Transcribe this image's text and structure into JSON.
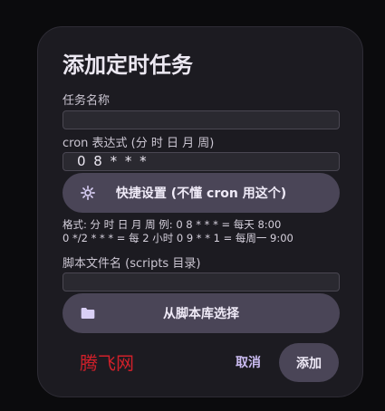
{
  "dialog": {
    "title": "添加定时任务",
    "task_name": {
      "label": "任务名称",
      "value": ""
    },
    "cron": {
      "label": "cron 表达式 (分 时 日 月 周)",
      "value": "0 8 * * *"
    },
    "quick_setup": {
      "icon": "gear-icon",
      "label": "快捷设置 (不懂 cron 用这个)"
    },
    "format_help": {
      "line1": "格式: 分 时 日 月 周  例: 0 8 * * * = 每天 8:00",
      "line2": "0 */2 * * * = 每 2 小时  0 9 * * 1 = 每周一 9:00"
    },
    "script_file": {
      "label": "脚本文件名 (scripts 目录)",
      "value": ""
    },
    "choose_from_library": {
      "icon": "folder-icon",
      "label": "从脚本库选择"
    },
    "watermark": "腾飞网",
    "cancel_label": "取消",
    "add_label": "添加"
  },
  "colors": {
    "dialog_bg": "#1c1b21",
    "pill_bg": "#4a4557",
    "accent_text": "#cbbcf2",
    "watermark": "#d0202a"
  }
}
